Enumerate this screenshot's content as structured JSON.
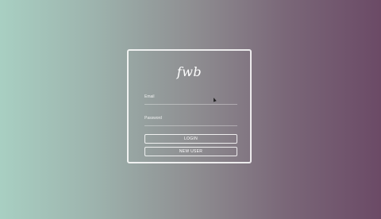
{
  "app": {
    "logo_text": "fwb"
  },
  "login_form": {
    "email_label": "Email",
    "email_value": "",
    "password_label": "Password",
    "password_value": "",
    "login_button_label": "LOGIN",
    "new_user_button_label": "NEW USER"
  },
  "colors": {
    "gradient_left": "#a8cfc2",
    "gradient_right": "#6b4a66",
    "card_border": "#ffffff"
  },
  "icons": {
    "cursor": "mouse-pointer-icon"
  }
}
